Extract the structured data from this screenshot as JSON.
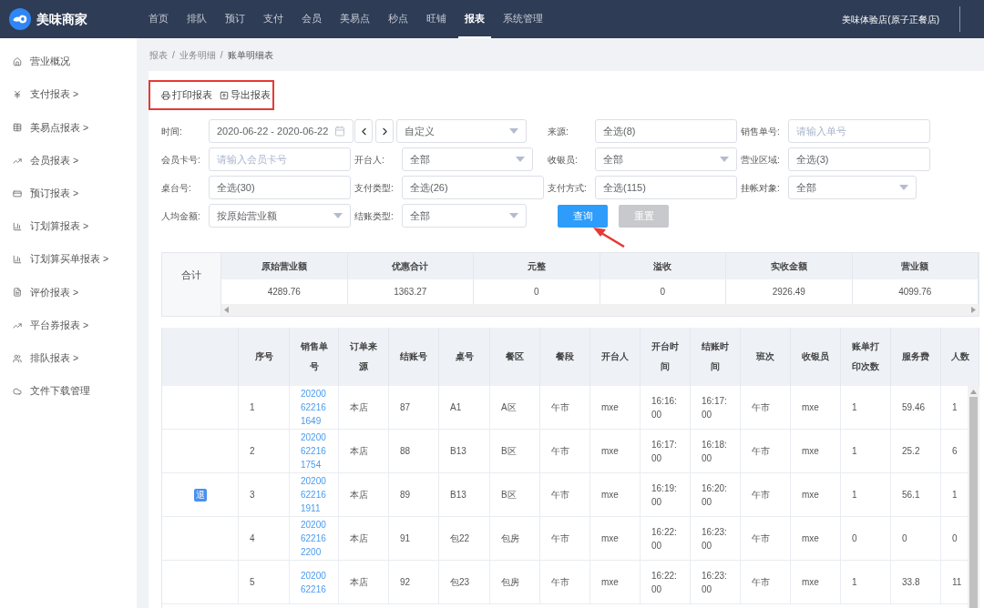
{
  "brand": "美味商家",
  "nav": [
    {
      "label": "首页",
      "selected": false
    },
    {
      "label": "排队",
      "selected": false
    },
    {
      "label": "预订",
      "selected": false
    },
    {
      "label": "支付",
      "selected": false
    },
    {
      "label": "会员",
      "selected": false
    },
    {
      "label": "美易点",
      "selected": false
    },
    {
      "label": "秒点",
      "selected": false
    },
    {
      "label": "旺铺",
      "selected": false
    },
    {
      "label": "报表",
      "selected": true
    },
    {
      "label": "系统管理",
      "selected": false
    }
  ],
  "store": "美味体验店(原子正餐店)",
  "sidebar": [
    {
      "label": "营业概况"
    },
    {
      "label": "支付报表 >"
    },
    {
      "label": "美易点报表 >"
    },
    {
      "label": "会员报表 >"
    },
    {
      "label": "预订报表 >"
    },
    {
      "label": "订划算报表 >"
    },
    {
      "label": "订划算买单报表 >"
    },
    {
      "label": "评价报表 >"
    },
    {
      "label": "平台券报表 >"
    },
    {
      "label": "排队报表 >"
    },
    {
      "label": "文件下载管理"
    }
  ],
  "breadcrumb": [
    "报表",
    "业务明细",
    "账单明细表"
  ],
  "breadcrumb_separator": "/",
  "toolbar": [
    {
      "label": "打印报表",
      "kind": "print"
    },
    {
      "label": "导出报表",
      "kind": "export"
    }
  ],
  "filters": [
    [
      {
        "label": "时间:",
        "kind": "date",
        "value": "2020-06-22 - 2020-06-22"
      },
      {
        "kind": "period",
        "value": "自定义"
      },
      {
        "label": "来源:",
        "kind": "input",
        "value": "全选(8)"
      },
      {
        "label": "销售单号:",
        "kind": "input",
        "placeholder": "请输入单号"
      }
    ],
    [
      {
        "label": "会员卡号:",
        "kind": "input",
        "placeholder": "请输入会员卡号"
      },
      {
        "label": "开台人:",
        "kind": "select",
        "value": "全部"
      },
      {
        "label": "收银员:",
        "kind": "select",
        "value": "全部"
      },
      {
        "label": "营业区域:",
        "kind": "input",
        "value": "全选(3)"
      }
    ],
    [
      {
        "label": "桌台号:",
        "kind": "input",
        "value": "全选(30)"
      },
      {
        "label": "支付类型:",
        "kind": "input",
        "value": "全选(26)"
      },
      {
        "label": "支付方式:",
        "kind": "input",
        "value": "全选(115)"
      },
      {
        "label": "挂帐对象:",
        "kind": "select",
        "value": "全部"
      }
    ],
    [
      {
        "label": "人均金额:",
        "kind": "select",
        "value": "按原始营业额"
      },
      {
        "label": "结账类型:",
        "kind": "select",
        "value": "全部"
      },
      {
        "kind": "buttons"
      }
    ]
  ],
  "buttons": [
    {
      "label": "查询",
      "disabled": false
    },
    {
      "label": "重置",
      "disabled": true
    }
  ],
  "summary": {
    "title": "合计",
    "columns": [
      {
        "header": "原始营业额",
        "value": "4289.76"
      },
      {
        "header": "优惠合计",
        "value": "1363.27"
      },
      {
        "header": "元整",
        "value": "0"
      },
      {
        "header": "溢收",
        "value": "0"
      },
      {
        "header": "实收金额",
        "value": "2926.49"
      },
      {
        "header": "营业额",
        "value": "4099.76"
      }
    ]
  },
  "table": {
    "columns": [
      "序号",
      "销售单号",
      "订单来源",
      "结账号",
      "桌号",
      "餐区",
      "餐段",
      "开台人",
      "开台时间",
      "结账时间",
      "班次",
      "收银员",
      "账单打印次数",
      "服务费",
      "人数"
    ],
    "rows": [
      {
        "cells": [
          "1",
          "20200622161649",
          "本店",
          "87",
          "A1",
          "A区",
          "午市",
          "mxe",
          "16:16:00",
          "16:17:00",
          "午市",
          "mxe",
          "1",
          "59.46",
          "1"
        ]
      },
      {
        "cells": [
          "2",
          "20200622161754",
          "本店",
          "88",
          "B13",
          "B区",
          "午市",
          "mxe",
          "16:17:00",
          "16:18:00",
          "午市",
          "mxe",
          "1",
          "25.2",
          "6"
        ]
      },
      {
        "badge": "退",
        "cells": [
          "3",
          "20200622161911",
          "本店",
          "89",
          "B13",
          "B区",
          "午市",
          "mxe",
          "16:19:00",
          "16:20:00",
          "午市",
          "mxe",
          "1",
          "56.1",
          "1"
        ]
      },
      {
        "cells": [
          "4",
          "20200622162200",
          "本店",
          "91",
          "包22",
          "包房",
          "午市",
          "mxe",
          "16:22:00",
          "16:23:00",
          "午市",
          "mxe",
          "0",
          "0",
          "0"
        ]
      },
      {
        "cells": [
          "5",
          "2020062216",
          "本店",
          "92",
          "包23",
          "包房",
          "午市",
          "mxe",
          "16:22:00",
          "16:23:00",
          "午市",
          "mxe",
          "1",
          "33.8",
          "11"
        ]
      }
    ]
  }
}
